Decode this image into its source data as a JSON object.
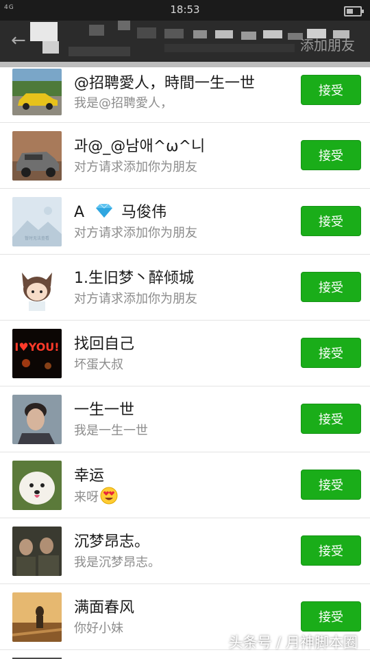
{
  "status_bar": {
    "time": "18:53",
    "signal": "4G"
  },
  "nav": {
    "add_friend": "添加朋友"
  },
  "accept_label": "接受",
  "requests": [
    {
      "name": "@招聘愛人，時間一生一世",
      "message": "我是@招聘愛人，",
      "avatar": "yellow-car-avatar"
    },
    {
      "name": "과@_@남애^ω^니",
      "message": "对方请求添加你为朋友",
      "avatar": "suv-avatar"
    },
    {
      "name_prefix": "A",
      "name_suffix": "马俊伟",
      "message": "对方请求添加你为朋友",
      "avatar": "placeholder-avatar",
      "avatar_caption": "暂时无法查看"
    },
    {
      "name": "1.生旧梦丶醉倾城",
      "message": "对方请求添加你为朋友",
      "avatar": "cartoon-girl-avatar"
    },
    {
      "name": "找回自己",
      "message": "坏蛋大叔",
      "avatar": "i-love-you-avatar",
      "avatar_text": "I♥YOU!"
    },
    {
      "name": "一生一世",
      "message": "我是一生一世",
      "avatar": "man-portrait-avatar"
    },
    {
      "name": "幸运",
      "message": "来呀",
      "avatar": "white-dog-avatar"
    },
    {
      "name": "沉梦昂志。",
      "message": "我是沉梦昂志。",
      "avatar": "soldiers-avatar"
    },
    {
      "name": "满面春风",
      "message": "你好小妹",
      "avatar": "sunset-person-avatar"
    }
  ],
  "watermark": "头条号 / 月神脚本圈",
  "colors": {
    "accept_green": "#1aad19",
    "nav_bg": "#2b2b2b",
    "status_bg": "#1b1b1b"
  }
}
